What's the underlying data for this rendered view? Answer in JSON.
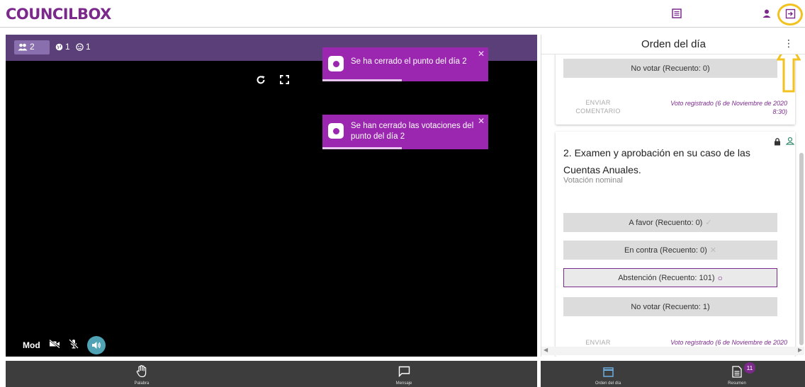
{
  "app": {
    "logo": "COUNCILBOX"
  },
  "video": {
    "stats": {
      "participants": "2",
      "online": "1",
      "guests": "1"
    },
    "mod_label": "Mod"
  },
  "toasts": [
    {
      "text": "Se ha cerrado el punto del día 2",
      "progress": 0.48
    },
    {
      "text": "Se han cerrado las votaciones del punto del día 2",
      "progress": 0.48
    }
  ],
  "agenda": {
    "title": "Orden del día",
    "previous_item": {
      "vote_option": "No votar (Recuento: 0)",
      "send_label": "ENVIAR COMENTARIO",
      "registered": "Voto registrado (6 de Noviembre de 2020 8:30)"
    },
    "item": {
      "title": "2. Examen y aprobación en su caso de las Cuentas Anuales.",
      "subtitle": "Votación nominal",
      "options": [
        {
          "label": "A favor (Recuento: 0)",
          "mark": "✓",
          "selected": false
        },
        {
          "label": "En contra (Recuento: 0)",
          "mark": "✕",
          "selected": false
        },
        {
          "label": "Abstención (Recuento: 101)",
          "mark": "○",
          "selected": true
        },
        {
          "label": "No votar (Recuento: 1)",
          "mark": "",
          "selected": false
        }
      ],
      "send_label": "ENVIAR",
      "registered": "Voto registrado (6 de Noviembre de 2020"
    }
  },
  "bottom_nav": {
    "palabra": "Palabra",
    "mensaje": "Mensaje",
    "orden": "Orden del día",
    "resumen": "Resumen",
    "resumen_badge": "11"
  },
  "colors": {
    "brand": "#7b2a8c",
    "toolbar": "#5a3f79",
    "toast": "#9b27b0",
    "highlight": "#f2c220",
    "mic": "#4fa3b5"
  }
}
